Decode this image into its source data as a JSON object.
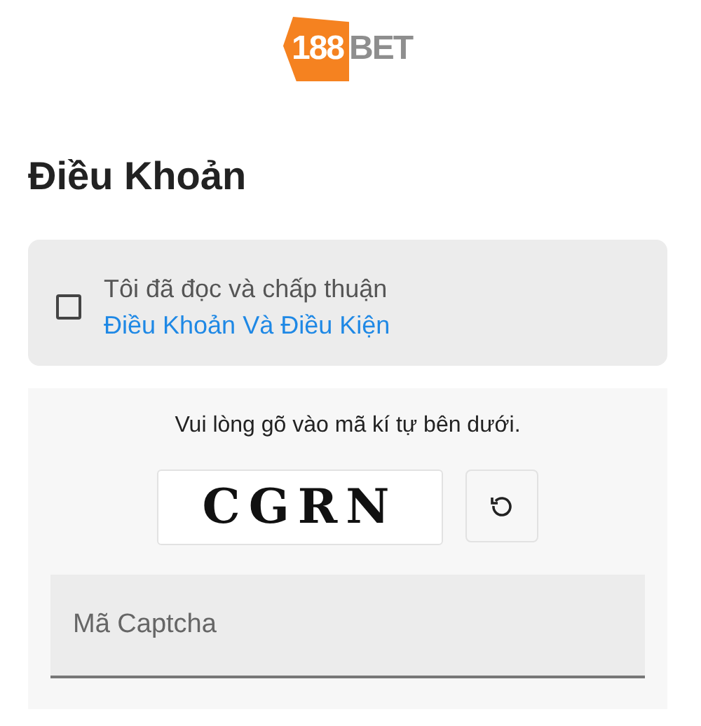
{
  "logo": {
    "number": "188",
    "word": "BET"
  },
  "title": "Điều Khoản",
  "terms": {
    "checked": false,
    "text": "Tôi đã đọc và chấp thuận ",
    "link": "Điều Khoản Và Điều Kiện"
  },
  "captcha": {
    "prompt": "Vui lòng gõ vào mã kí tự bên dưới.",
    "code": "CGRN",
    "placeholder": "Mã Captcha"
  }
}
